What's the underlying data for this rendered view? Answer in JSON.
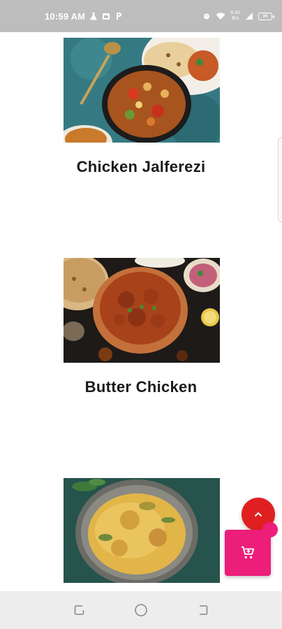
{
  "status_bar": {
    "time": "10:59 AM",
    "left_icons": [
      "lab-flask-icon",
      "calendar-icon",
      "p-icon"
    ],
    "speed_top": "6.40",
    "speed_bottom": "B/s",
    "battery": "96"
  },
  "menu": {
    "items": [
      {
        "name": "Chicken Jalferezi",
        "image": "chicken-jalferezi-photo"
      },
      {
        "name": "Butter Chicken",
        "image": "butter-chicken-photo"
      },
      {
        "name": "",
        "image": "chicken-biryani-photo"
      }
    ]
  },
  "actions": {
    "scroll_up_icon": "chevron-up-icon",
    "cart_icon": "add-to-cart-icon"
  },
  "navigation": {
    "buttons": [
      "recents-icon",
      "home-icon",
      "back-icon"
    ]
  },
  "colors": {
    "status_bar": "#bdbdbd",
    "scroll_up_button": "#e02020",
    "cart_button": "#ec1e79",
    "nav_bar": "#ededed"
  }
}
